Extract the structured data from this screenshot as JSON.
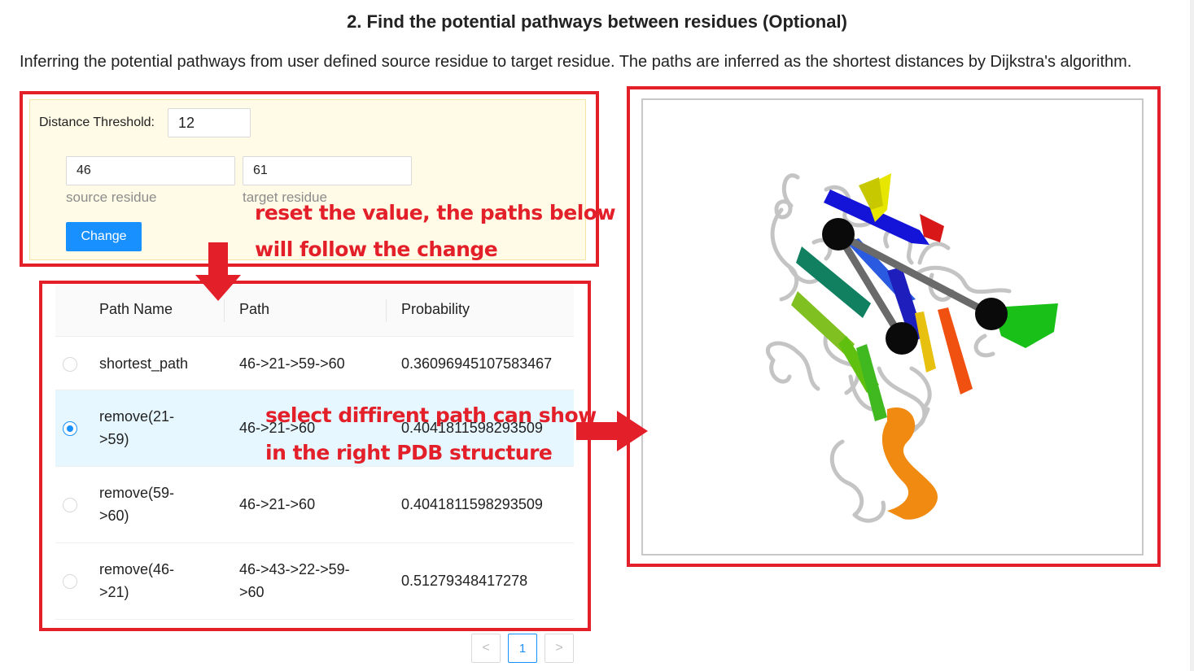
{
  "page": {
    "heading": "2. Find the potential pathways between residues (Optional)",
    "description": "Inferring the potential pathways from user defined source residue to target residue. The paths are inferred as the shortest distances by Dijkstra's algorithm."
  },
  "form": {
    "distance_threshold_label": "Distance Threshold:",
    "distance_threshold_value": "12",
    "source_value": "46",
    "source_hint": "source residue",
    "target_value": "61",
    "target_hint": "target residue",
    "change_label": "Change"
  },
  "table": {
    "columns": [
      "Path Name",
      "Path",
      "Probability"
    ],
    "rows": [
      {
        "name": [
          "shortest_path"
        ],
        "path": [
          "46->21->59->60"
        ],
        "probability": "0.36096945107583467",
        "selected": false
      },
      {
        "name": [
          "remove(21-",
          ">59)"
        ],
        "path": [
          "46->21->60"
        ],
        "probability": "0.4041811598293509",
        "selected": true
      },
      {
        "name": [
          "remove(59-",
          ">60)"
        ],
        "path": [
          "46->21->60"
        ],
        "probability": "0.4041811598293509",
        "selected": false
      },
      {
        "name": [
          "remove(46-",
          ">21)"
        ],
        "path": [
          "46->43->22->59-",
          ">60"
        ],
        "probability": "0.51279348417278",
        "selected": false
      }
    ]
  },
  "pagination": {
    "prev": "<",
    "current": "1",
    "next": ">"
  },
  "annotations": {
    "form_note_line1": "reset the value, the paths below",
    "form_note_line2": "will follow the change",
    "table_note_line1": "select diffirent path can show",
    "table_note_line2": "in the right PDB structure"
  },
  "colors": {
    "accent": "#1890ff",
    "annotation_red": "#e3202a",
    "form_bg": "#fffbe6",
    "selected_row_bg": "#e6f7ff"
  },
  "viewer": {
    "content": "3D protein cartoon structure (rainbow ribbons, gray loops, black residue spheres connected by path stick)"
  }
}
